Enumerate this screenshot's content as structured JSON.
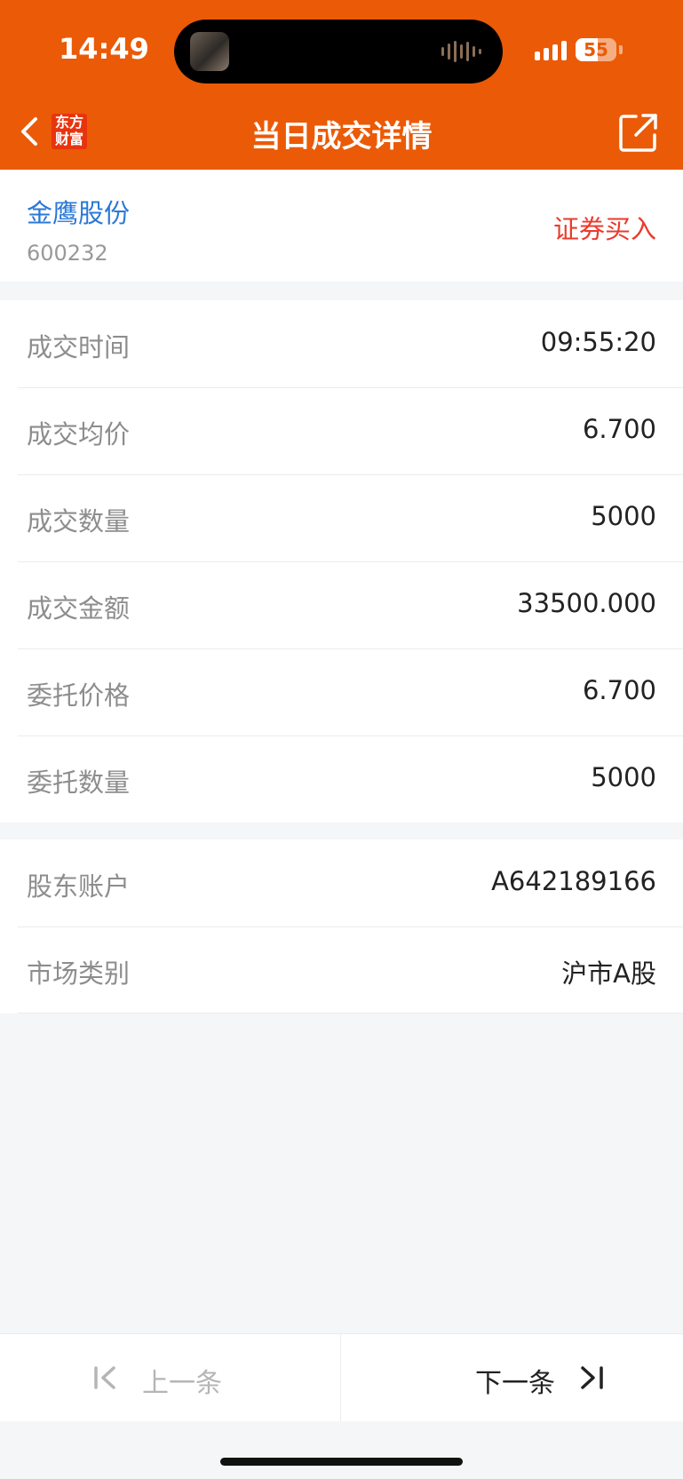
{
  "status_bar": {
    "time": "14:49",
    "battery": "55"
  },
  "header": {
    "logo_line1": "东方",
    "logo_line2": "财富",
    "title": "当日成交详情",
    "back_icon": "chevron-left-icon",
    "share_icon": "share-external-icon",
    "background_color": "#eb5a06"
  },
  "stock": {
    "name": "金鹰股份",
    "code": "600232",
    "trade_type": "证券买入",
    "name_color": "#2a78d6",
    "trade_type_color": "#ea3b2c"
  },
  "details": [
    {
      "label": "成交时间",
      "value": "09:55:20"
    },
    {
      "label": "成交均价",
      "value": "6.700"
    },
    {
      "label": "成交数量",
      "value": "5000"
    },
    {
      "label": "成交金额",
      "value": "33500.000"
    },
    {
      "label": "委托价格",
      "value": "6.700"
    },
    {
      "label": "委托数量",
      "value": "5000"
    }
  ],
  "account": [
    {
      "label": "股东账户",
      "value": "A642189166"
    },
    {
      "label": "市场类别",
      "value": "沪市A股"
    }
  ],
  "footer": {
    "prev_label": "上一条",
    "next_label": "下一条",
    "prev_icon": "skip-previous-icon",
    "next_icon": "skip-next-icon"
  }
}
